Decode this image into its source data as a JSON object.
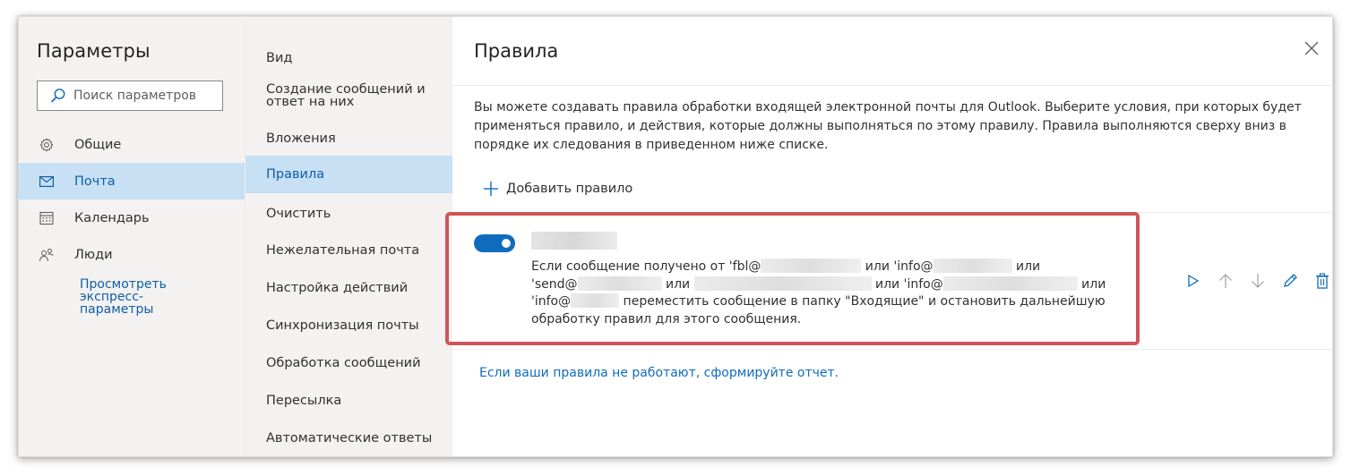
{
  "settings": {
    "title": "Параметры",
    "search_placeholder": "Поиск параметров",
    "nav": [
      {
        "label": "Общие",
        "icon": "gear-icon"
      },
      {
        "label": "Почта",
        "icon": "mail-icon",
        "active": true
      },
      {
        "label": "Календарь",
        "icon": "calendar-icon"
      },
      {
        "label": "Люди",
        "icon": "people-icon"
      }
    ],
    "quick_settings_link": [
      "Просмотреть",
      "экспресс-",
      "параметры"
    ]
  },
  "mail_nav": [
    {
      "label": "Вид"
    },
    {
      "label": "Создание сообщений и ответ на них"
    },
    {
      "label": "Вложения"
    },
    {
      "label": "Правила",
      "active": true
    },
    {
      "label": "Очистить"
    },
    {
      "label": "Нежелательная почта"
    },
    {
      "label": "Настройка действий"
    },
    {
      "label": "Синхронизация почты"
    },
    {
      "label": "Обработка сообщений"
    },
    {
      "label": "Пересылка"
    },
    {
      "label": "Автоматические ответы"
    }
  ],
  "rules": {
    "title": "Правила",
    "description": "Вы можете создавать правила обработки входящей электронной почты для Outlook. Выберите условия, при которых будет применяться правило, и действия, которые должны выполняться по этому правилу. Правила выполняются сверху вниз в порядке их следования в приведенном ниже списке.",
    "add_rule_label": "Добавить правило",
    "rule": {
      "enabled": true,
      "text": {
        "p1": "Если сообщение получено от 'fbl@",
        "p2": " или 'info@",
        "p3": " или",
        "p4": "'send@",
        "p5": " или ",
        "p6": " или 'info@",
        "p7": " или",
        "p8": "'info@",
        "p9": " переместить сообщение в папку \"Входящие\" и остановить дальнейшую",
        "p10": "обработку правил для этого сообщения."
      }
    },
    "report_link": "Если ваши правила не работают, сформируйте отчет."
  },
  "colors": {
    "accent": "#0f6cbd",
    "selected_bg": "#c7e0f4",
    "highlight_border": "#d0555a"
  }
}
